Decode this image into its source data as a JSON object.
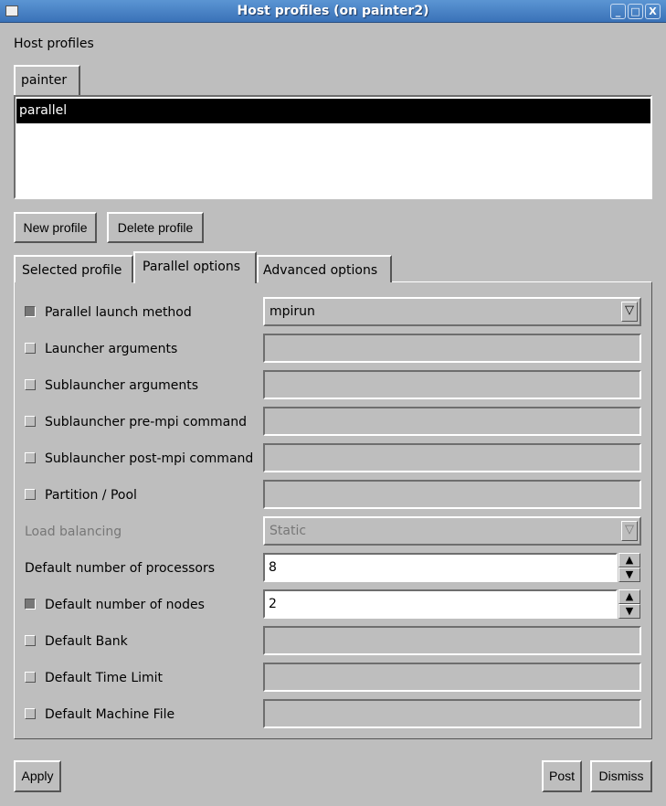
{
  "window": {
    "title": "Host profiles (on painter2)",
    "buttons": {
      "minimize": "_",
      "maximize": "□",
      "close": "X"
    }
  },
  "section_label": "Host profiles",
  "host_tabs": [
    {
      "label": "painter",
      "active": true
    }
  ],
  "profiles": [
    {
      "label": "parallel",
      "selected": true
    }
  ],
  "profile_buttons": {
    "new": "New profile",
    "delete": "Delete profile"
  },
  "option_tabs": [
    {
      "label": "Selected profile",
      "active": false
    },
    {
      "label": "Parallel options",
      "active": true
    },
    {
      "label": "Advanced options",
      "active": false
    }
  ],
  "options": {
    "launch_method": {
      "label": "Parallel launch method",
      "checked": true,
      "value": "mpirun"
    },
    "launcher_args": {
      "label": "Launcher arguments",
      "checked": false,
      "value": ""
    },
    "sublauncher_args": {
      "label": "Sublauncher arguments",
      "checked": false,
      "value": ""
    },
    "sublauncher_pre": {
      "label": "Sublauncher pre-mpi command",
      "checked": false,
      "value": ""
    },
    "sublauncher_post": {
      "label": "Sublauncher post-mpi command",
      "checked": false,
      "value": ""
    },
    "partition": {
      "label": "Partition / Pool",
      "checked": false,
      "value": ""
    },
    "load_balancing": {
      "label": "Load balancing",
      "enabled": false,
      "value": "Static"
    },
    "num_processors": {
      "label": "Default number of processors",
      "value": "8"
    },
    "num_nodes": {
      "label": "Default number of nodes",
      "checked": true,
      "value": "2"
    },
    "bank": {
      "label": "Default Bank",
      "checked": false,
      "value": ""
    },
    "time_limit": {
      "label": "Default Time Limit",
      "checked": false,
      "value": ""
    },
    "machine_file": {
      "label": "Default Machine File",
      "checked": false,
      "value": ""
    }
  },
  "footer": {
    "apply": "Apply",
    "post": "Post",
    "dismiss": "Dismiss"
  },
  "icons": {
    "combo_arrow": "▽",
    "spin_up": "▲",
    "spin_down": "▼"
  }
}
